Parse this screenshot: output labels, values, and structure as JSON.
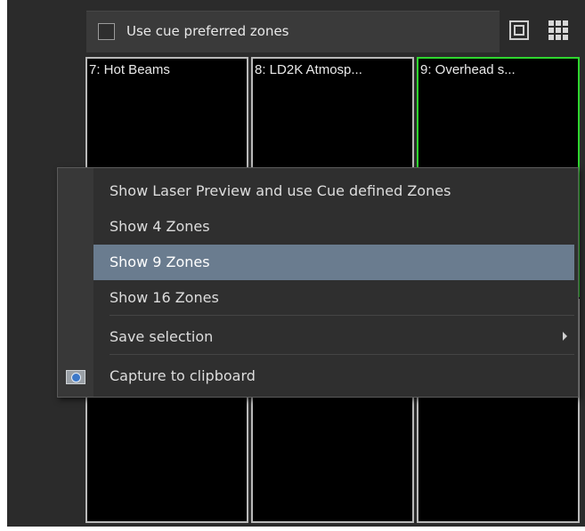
{
  "toolbar": {
    "cue_checkbox_label": "Use cue preferred zones",
    "cue_checkbox_checked": false,
    "single_view_icon": "single-view-icon",
    "grid_view_icon": "grid-view-icon"
  },
  "zones": [
    {
      "title": "7: Hot Beams",
      "selected": false
    },
    {
      "title": "8: LD2K Atmosp...",
      "selected": false
    },
    {
      "title": "9: Overhead s...",
      "selected": true
    },
    {
      "title": "",
      "selected": false
    },
    {
      "title": "",
      "selected": false
    },
    {
      "title": "",
      "selected": false
    }
  ],
  "context_menu": {
    "items": [
      {
        "label": "Show Laser Preview and use Cue defined Zones"
      },
      {
        "label": "Show 4 Zones"
      },
      {
        "label": "Show 9 Zones",
        "highlighted": true
      },
      {
        "label": "Show 16 Zones"
      },
      {
        "label": "Save selection",
        "has_submenu": true
      },
      {
        "label": "Capture to clipboard",
        "icon": "camera-icon"
      }
    ]
  },
  "colors": {
    "selected_zone_border": "#2fd52f",
    "menu_highlight": "#6a7c8f"
  }
}
